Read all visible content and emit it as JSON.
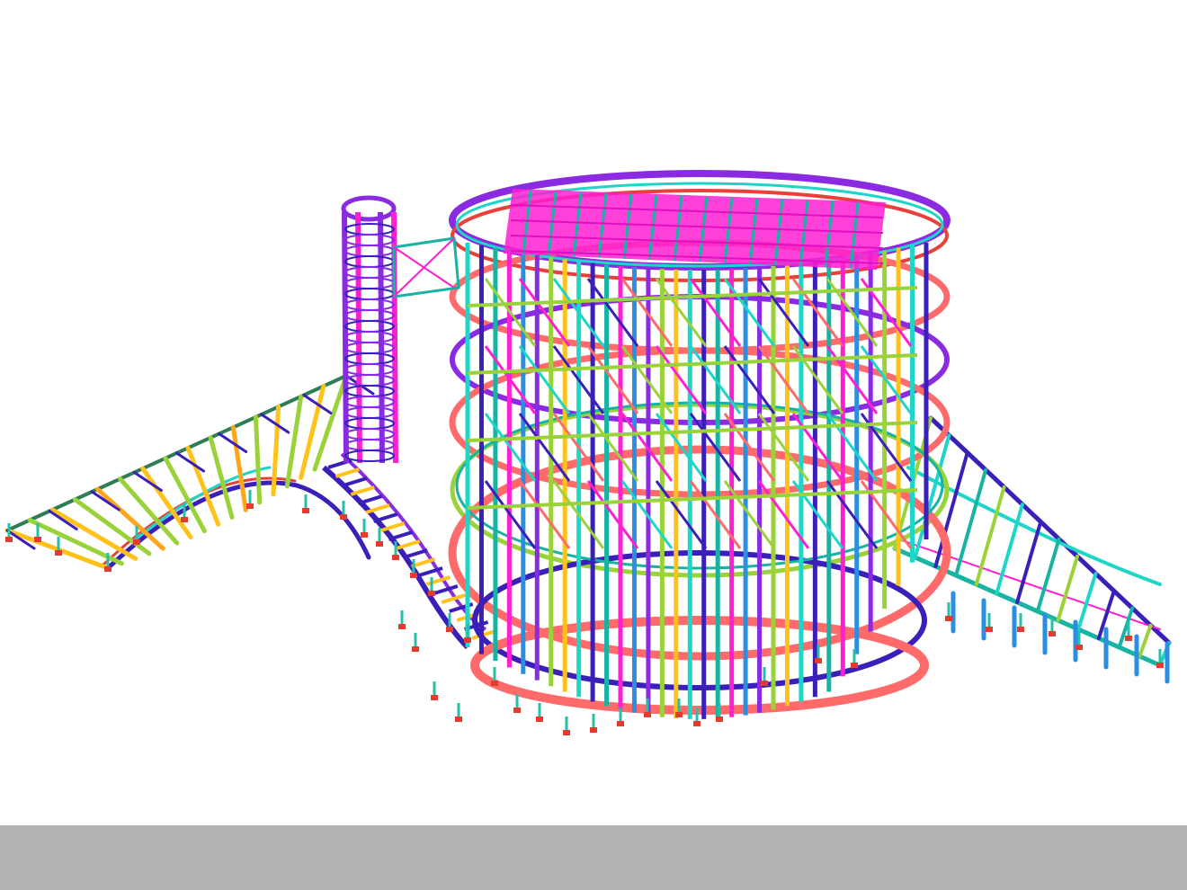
{
  "viewport": {
    "background": "#ffffff",
    "model": "steel-structure-3d-wireframe",
    "palette": {
      "magenta": "#ff1fd2",
      "purple": "#8a2be2",
      "indigo": "#3a1fb8",
      "cyan": "#1ed6c8",
      "teal": "#17b3a3",
      "salmon": "#ff6a6a",
      "red": "#e8403a",
      "lime": "#9ad23a",
      "yellow": "#ffc21a",
      "orange": "#ffa51a",
      "blue": "#2a8fe0",
      "support": "#e53b2e"
    }
  },
  "status_bar": {
    "background": "#b4b4b4"
  }
}
